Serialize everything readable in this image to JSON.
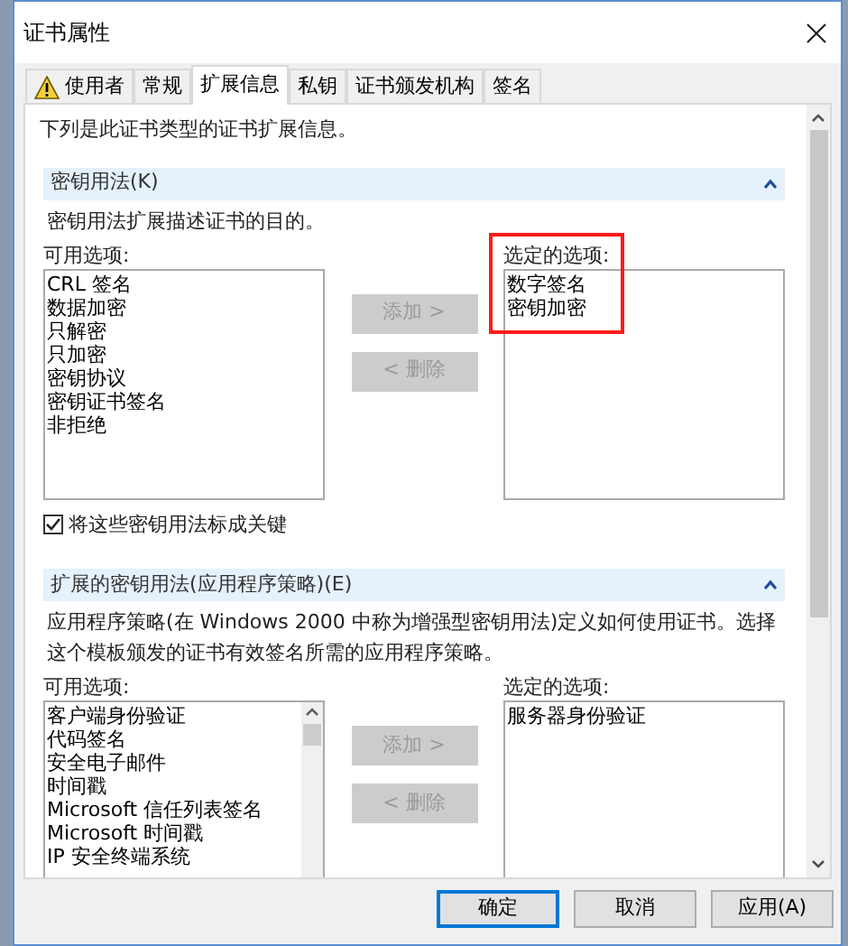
{
  "window": {
    "title": "证书属性"
  },
  "tabs": [
    {
      "label": "使用者",
      "selected": false,
      "warning": true
    },
    {
      "label": "常规",
      "selected": false,
      "warning": false
    },
    {
      "label": "扩展信息",
      "selected": true,
      "warning": false
    },
    {
      "label": "私钥",
      "selected": false,
      "warning": false
    },
    {
      "label": "证书颁发机构",
      "selected": false,
      "warning": false
    },
    {
      "label": "签名",
      "selected": false,
      "warning": false
    }
  ],
  "intro": "下列是此证书类型的证书扩展信息。",
  "sections": [
    {
      "title": "密钥用法(K)",
      "expanded": true,
      "description": "密钥用法扩展描述证书的目的。",
      "available_label": "可用选项:",
      "available": [
        "CRL 签名",
        "数据加密",
        "只解密",
        "只加密",
        "密钥协议",
        "密钥证书签名",
        "非拒绝"
      ],
      "available_scrollbar": false,
      "add_button": {
        "label": "添加 >",
        "disabled": true
      },
      "remove_button": {
        "label": "< 删除",
        "disabled": true
      },
      "selected_label": "选定的选项:",
      "selected_options": [
        "数字签名",
        "密钥加密"
      ],
      "highlighted": true,
      "checkbox": {
        "label": "将这些密钥用法标成关键",
        "checked": true
      }
    },
    {
      "title": "扩展的密钥用法(应用程序策略)(E)",
      "expanded": true,
      "description": "应用程序策略(在 Windows 2000 中称为增强型密钥用法)定义如何使用证书。选择这个模板颁发的证书有效签名所需的应用程序策略。",
      "available_label": "可用选项:",
      "available": [
        "客户端身份验证",
        "代码签名",
        "安全电子邮件",
        "时间戳",
        "Microsoft 信任列表签名",
        "Microsoft 时间戳",
        "IP 安全终端系统"
      ],
      "available_scrollbar": true,
      "add_button": {
        "label": "添加 >",
        "disabled": true
      },
      "remove_button": {
        "label": "< 删除",
        "disabled": true
      },
      "selected_label": "选定的选项:",
      "selected_options": [
        "服务器身份验证"
      ],
      "highlighted": false
    }
  ],
  "buttons": [
    {
      "label": "确定",
      "default": true
    },
    {
      "label": "取消",
      "default": false
    },
    {
      "label": "应用(A)",
      "default": false
    }
  ]
}
